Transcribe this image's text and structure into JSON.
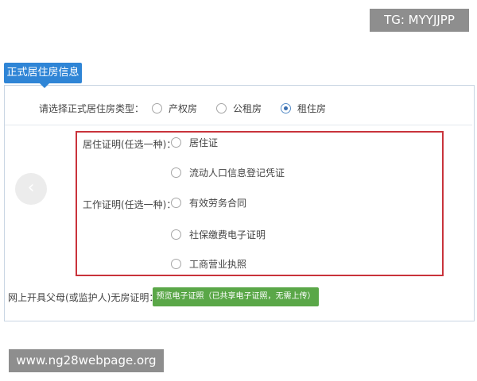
{
  "watermarks": {
    "top": "TG: MYYJJPP",
    "bottom": "www.ng28webpage.org"
  },
  "section": {
    "title": "正式居住房信息"
  },
  "housing_type": {
    "question": "请选择正式居住房类型：",
    "options": [
      {
        "label": "产权房",
        "checked": false
      },
      {
        "label": "公租房",
        "checked": false
      },
      {
        "label": "租住房",
        "checked": true
      }
    ]
  },
  "residence_proof": {
    "label": "居住证明(任选一种)：",
    "options": [
      "居住证",
      "流动人口信息登记凭证"
    ]
  },
  "work_proof": {
    "label": "工作证明(任选一种)：",
    "options": [
      "有效劳务合同",
      "社保缴费电子证明",
      "工商营业执照"
    ]
  },
  "no_house_proof": {
    "label": "网上开具父母(或监护人)无房证明：",
    "button": "预览电子证照（已共享电子证照，无需上传）"
  },
  "nav": {
    "prev_glyph": "‹"
  },
  "colors": {
    "tag_blue": "#2f85d6",
    "highlight_red": "#c9333b",
    "button_green": "#5aa748"
  }
}
